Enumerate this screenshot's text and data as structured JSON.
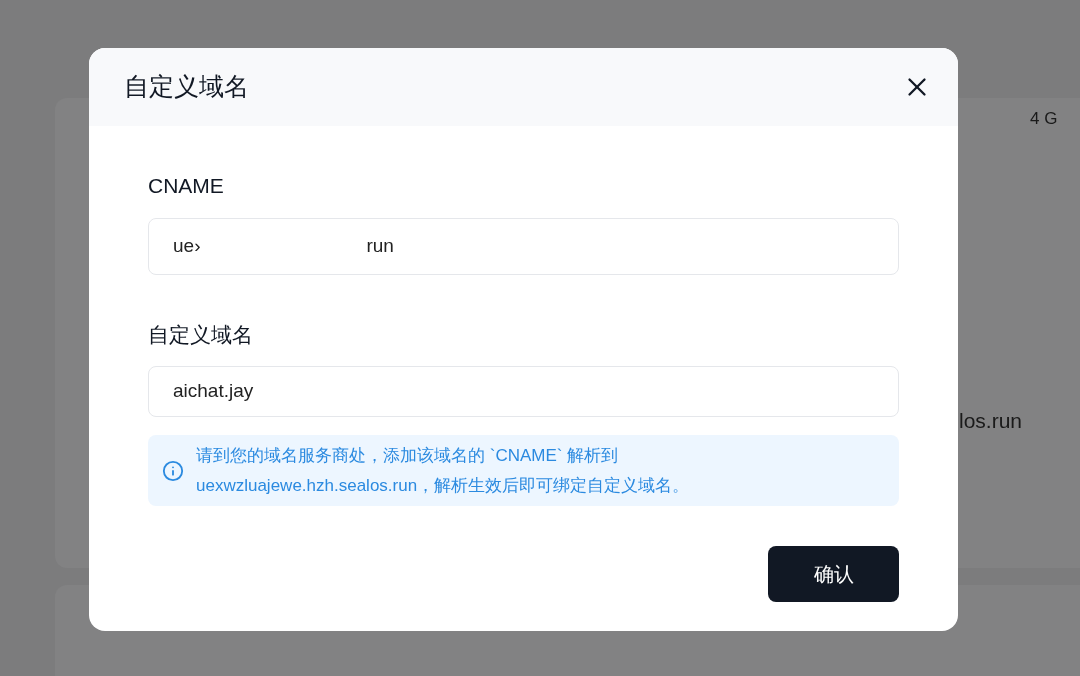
{
  "background": {
    "memory": "4 G",
    "domain_tail": "los.run"
  },
  "dialog": {
    "title": "自定义域名",
    "fields": [
      {
        "label": "CNAME",
        "value_fragments": [
          "ue›",
          "run"
        ]
      },
      {
        "label": "自定义域名",
        "value_fragments": [
          "aichat.jay"
        ]
      }
    ],
    "notice": "请到您的域名服务商处，添加该域名的 `CNAME` 解析到 uexwzluajewe.hzh.sealos.run，解析生效后即可绑定自定义域名。",
    "confirm": "确认"
  }
}
